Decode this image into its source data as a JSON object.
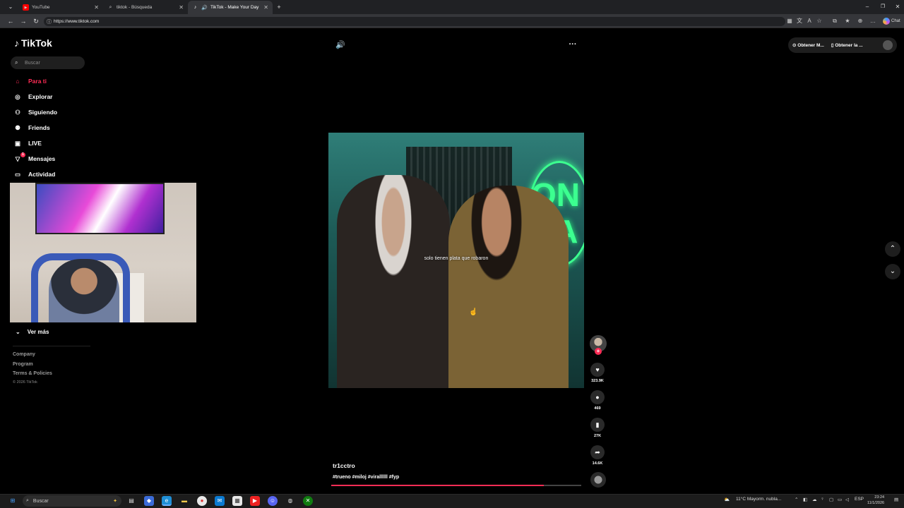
{
  "browser": {
    "tabs": [
      {
        "title": "YouTube"
      },
      {
        "title": "tiktok - Búsqueda"
      },
      {
        "title": "TikTok - Make Your Day"
      }
    ],
    "url": "https://www.tiktok.com",
    "copilot_label": "Chat"
  },
  "sidebar": {
    "brand": "TikTok",
    "search_placeholder": "Buscar",
    "items": [
      {
        "label": "Para ti"
      },
      {
        "label": "Explorar"
      },
      {
        "label": "Siguiendo"
      },
      {
        "label": "Friends"
      },
      {
        "label": "LIVE"
      },
      {
        "label": "Mensajes",
        "badge": "1"
      },
      {
        "label": "Actividad"
      }
    ],
    "see_more": "Ver más",
    "footer": [
      "Company",
      "Program",
      "Terms & Policies"
    ],
    "copyright": "© 2026 TikTok"
  },
  "topbar": {
    "get_app_1": "Obtener M...",
    "get_app_2": "Obtener la ..."
  },
  "video": {
    "subtitle": "solo tienen plata que robaron",
    "neon_text_1": "ON",
    "neon_text_2": "RA",
    "author": "tr1cctro",
    "hashtags": "#trueno #miloj #virallllll #fyp",
    "progress": 0.85,
    "likes": "323.9K",
    "comments": "469",
    "saves": "27K",
    "shares": "14.6K"
  },
  "taskbar": {
    "search_placeholder": "Buscar",
    "weather": "11°C  Mayorm. nubla...",
    "language": "ESP",
    "time": "23:24",
    "date": "11/1/2026"
  },
  "colors": {
    "accent": "#fe2c55"
  }
}
